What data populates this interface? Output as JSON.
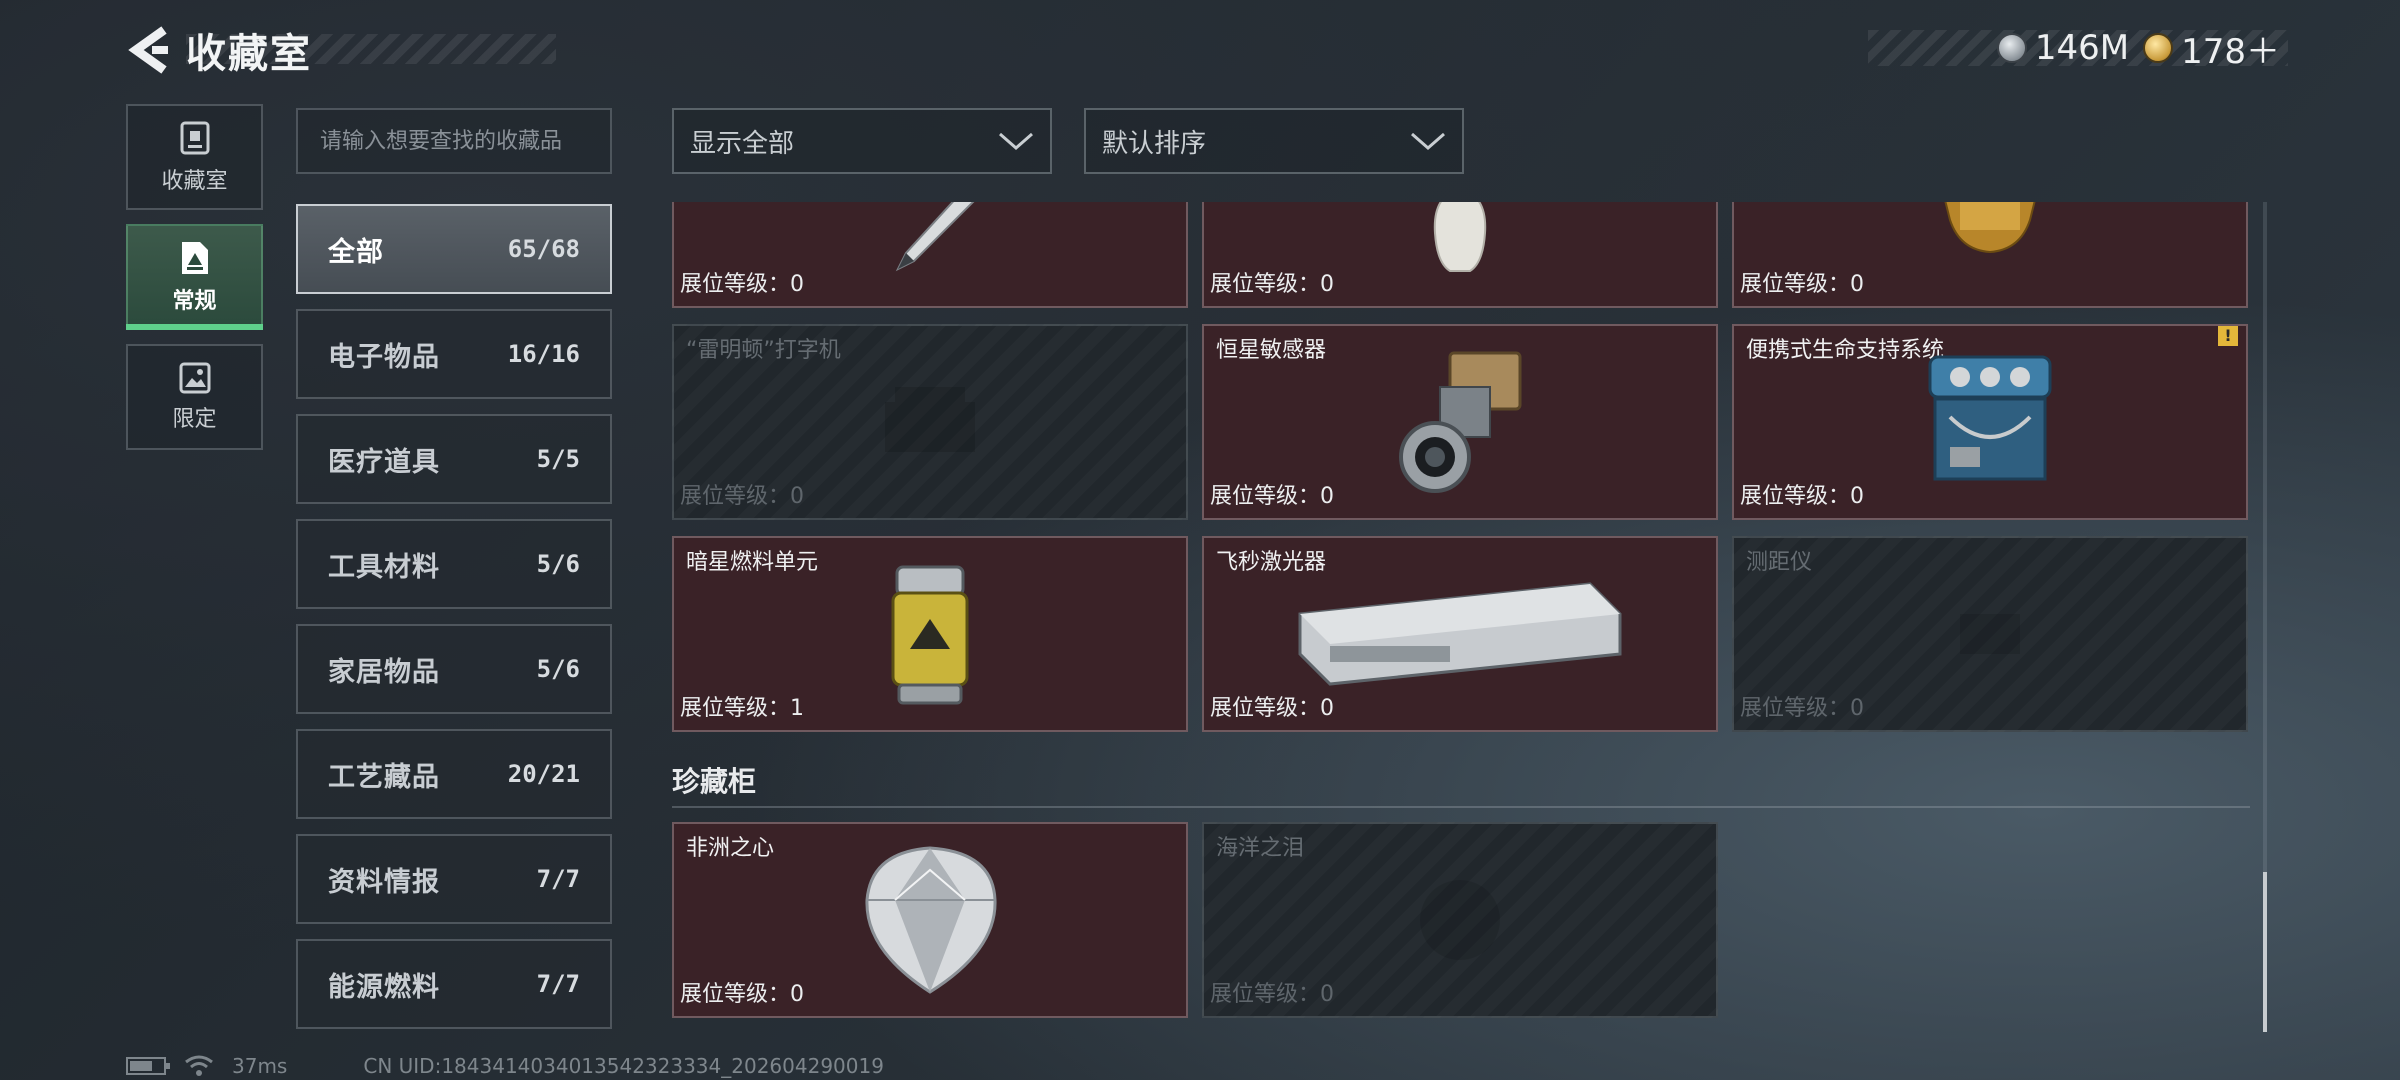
{
  "header": {
    "title": "收藏室",
    "currencies": [
      {
        "icon": "silver-coin-icon",
        "value": "146M"
      },
      {
        "icon": "gold-coin-icon",
        "value": "178＋"
      }
    ]
  },
  "leftnav": {
    "items": [
      {
        "label": "收藏室",
        "icon": "trophy-icon",
        "active": false
      },
      {
        "label": "常规",
        "icon": "document-icon",
        "active": true
      },
      {
        "label": "限定",
        "icon": "image-icon",
        "active": false
      }
    ]
  },
  "search": {
    "placeholder": "请输入想要查找的收藏品"
  },
  "categories": [
    {
      "name": "全部",
      "count": "65/68",
      "active": true
    },
    {
      "name": "电子物品",
      "count": "16/16"
    },
    {
      "name": "医疗道具",
      "count": "5/5"
    },
    {
      "name": "工具材料",
      "count": "5/6"
    },
    {
      "name": "家居物品",
      "count": "5/6"
    },
    {
      "name": "工艺藏品",
      "count": "20/21"
    },
    {
      "name": "资料情报",
      "count": "7/7"
    },
    {
      "name": "能源燃料",
      "count": "7/7"
    }
  ],
  "filters": {
    "show": "显示全部",
    "sort": "默认排序"
  },
  "cards": [
    {
      "name": "",
      "level": "展位等级：0",
      "locked": false,
      "art": "pen"
    },
    {
      "name": "",
      "level": "展位等级：0",
      "locked": false,
      "art": "vase"
    },
    {
      "name": "",
      "level": "展位等级：0",
      "locked": false,
      "art": "gold-statue"
    },
    {
      "name": "“雷明顿”打字机",
      "level": "展位等级：0",
      "locked": true,
      "art": "typewriter"
    },
    {
      "name": "恒星敏感器",
      "level": "展位等级：0",
      "locked": false,
      "art": "star-sensor"
    },
    {
      "name": "便携式生命支持系统",
      "level": "展位等级：0",
      "locked": false,
      "art": "life-support",
      "warning": "!"
    },
    {
      "name": "暗星燃料单元",
      "level": "展位等级：1",
      "locked": false,
      "art": "fuel-cell"
    },
    {
      "name": "飞秒激光器",
      "level": "展位等级：0",
      "locked": false,
      "art": "laser"
    },
    {
      "name": "测距仪",
      "level": "展位等级：0",
      "locked": true,
      "art": "rangefinder"
    }
  ],
  "treasure": {
    "title": "珍藏柜",
    "cards": [
      {
        "name": "非洲之心",
        "level": "展位等级：0",
        "locked": false,
        "art": "diamond"
      },
      {
        "name": "海洋之泪",
        "level": "展位等级：0",
        "locked": true,
        "art": "pearl"
      }
    ]
  },
  "footer": {
    "ping": "37ms",
    "uid": "CN UID:1843414034013542323334_202604290019"
  }
}
